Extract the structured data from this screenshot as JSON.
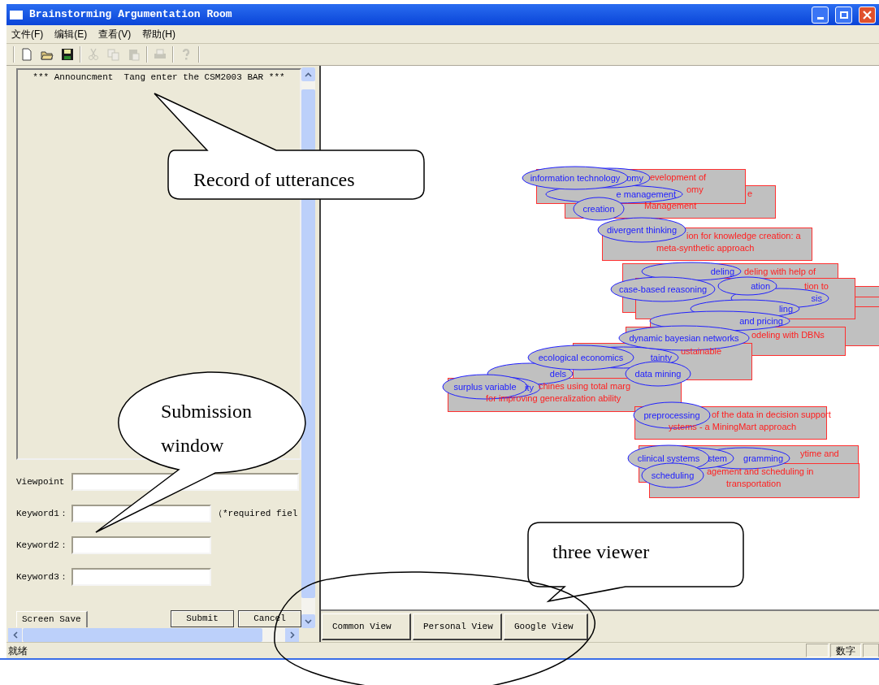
{
  "window": {
    "title": "Brainstorming Argumentation Room"
  },
  "menu": [
    "文件(F)",
    "编辑(E)",
    "查看(V)",
    "帮助(H)"
  ],
  "toolbar": [
    {
      "kind": "new",
      "disabled": false
    },
    {
      "kind": "open",
      "disabled": false
    },
    {
      "kind": "save",
      "disabled": false
    },
    {
      "kind": "cut",
      "disabled": true
    },
    {
      "kind": "copy",
      "disabled": true
    },
    {
      "kind": "paste",
      "disabled": true
    },
    {
      "kind": "print",
      "disabled": true
    },
    {
      "kind": "help",
      "disabled": true
    }
  ],
  "record": {
    "lines": [
      "*** Announcment  Tang enter the CSM2003 BAR ***"
    ]
  },
  "form": {
    "fields": [
      {
        "label": "Viewpoint"
      },
      {
        "label": "Keyword1：",
        "note": "（*required fiel"
      },
      {
        "label": "Keyword2："
      },
      {
        "label": "Keyword3："
      }
    ],
    "tab_button": "Screen Save",
    "buttons": [
      "Submit",
      "Cancel"
    ]
  },
  "graph": {
    "papers": [
      {
        "kind": "paper",
        "lines": [
          "evelopment of",
          "omy"
        ]
      },
      {
        "kind": "paper",
        "lines": [
          "e",
          "Management"
        ]
      },
      {
        "kind": "paper",
        "lines": [
          "ion for knowledge creation: a",
          "meta-synthetic approach"
        ]
      },
      {
        "kind": "paper",
        "lines": [
          "deling with help of"
        ]
      },
      {
        "kind": "paper",
        "lines": [
          "tion to"
        ]
      },
      {
        "kind": "paper"
      },
      {
        "kind": "paper"
      },
      {
        "kind": "paper"
      },
      {
        "kind": "paper",
        "lines": [
          "odeling with DBNs"
        ]
      },
      {
        "kind": "paper",
        "lines": [
          "ustainable"
        ]
      },
      {
        "kind": "paper",
        "lines": [
          "chines using total marg",
          "for improving generalization ability"
        ]
      },
      {
        "kind": "paper",
        "lines": [
          "of the data in decision support",
          "ystems - a MiningMart approach"
        ]
      },
      {
        "kind": "paper",
        "lines": [
          "ytime and"
        ]
      },
      {
        "kind": "paper",
        "lines": [
          "agement and scheduling in",
          "transportation"
        ]
      }
    ],
    "keywords": [
      "information technology",
      "omy",
      "e management",
      "creation",
      "divergent thinking",
      "deling",
      "ation",
      "case-based reasoning",
      "sis",
      "ling",
      "and pricing",
      "dynamic bayesian networks",
      "ecological economics",
      "tainty",
      "dels",
      "data mining",
      "surplus variable",
      "ity",
      "preprocessing",
      "clinical systems",
      "stem",
      "gramming",
      "scheduling"
    ]
  },
  "views": [
    {
      "label": "Common View",
      "selected": false
    },
    {
      "label": "Personal View",
      "selected": false
    },
    {
      "label": "Google View",
      "selected": false
    }
  ],
  "status_bar": {
    "text": "就绪",
    "panes": [
      "数字"
    ]
  },
  "annotations": [
    {
      "kind": "box",
      "lines": [
        "Record of utterances"
      ]
    },
    {
      "kind": "oval",
      "lines": [
        "Submission",
        "window"
      ]
    },
    {
      "kind": "box",
      "lines": [
        "three viewer"
      ]
    },
    {
      "kind": "ring"
    }
  ]
}
